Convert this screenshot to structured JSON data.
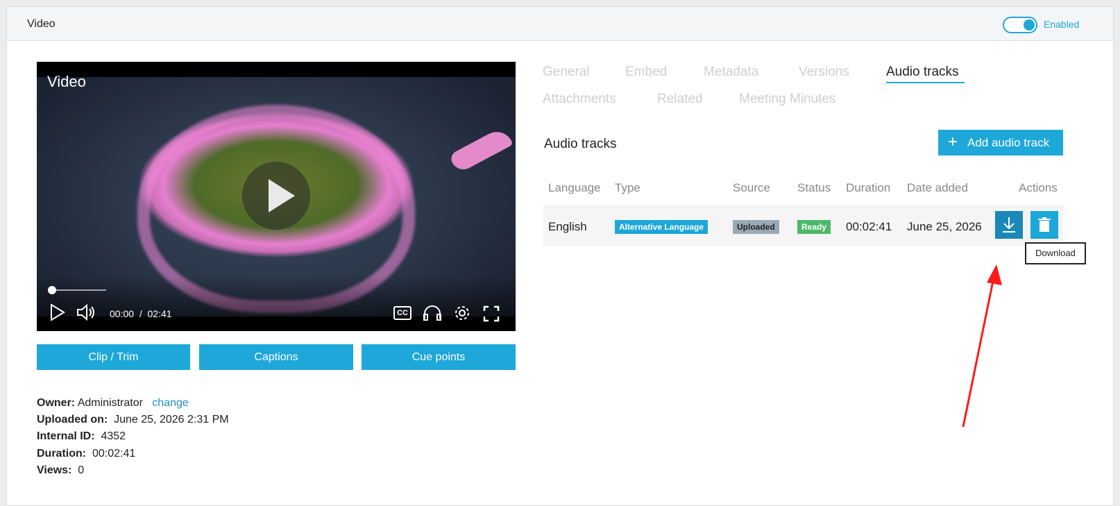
{
  "header": {
    "title": "Video",
    "toggle_label": "Enabled"
  },
  "player": {
    "title": "Video",
    "current_time": "00:00",
    "separator": "/",
    "total_time": "02:41",
    "cc_label": "CC",
    "progress_fraction": 0.03
  },
  "video_buttons": [
    {
      "label": "Clip / Trim"
    },
    {
      "label": "Captions"
    },
    {
      "label": "Cue points"
    }
  ],
  "info": {
    "owner_label": "Owner:",
    "owner_value": "Administrator",
    "owner_change": "change",
    "uploaded_label": "Uploaded on:",
    "uploaded_value": "June 25, 2026 2:31 PM",
    "id_label": "Internal ID:",
    "id_value": "4352",
    "duration_label": "Duration:",
    "duration_value": "00:02:41",
    "views_label": "Views:",
    "views_value": "0"
  },
  "tabs": [
    {
      "label": "General"
    },
    {
      "label": "Embed"
    },
    {
      "label": "Metadata"
    },
    {
      "label": "Versions"
    },
    {
      "label": "Audio tracks"
    },
    {
      "label": "Attachments"
    },
    {
      "label": "Related"
    },
    {
      "label": "Meeting Minutes"
    }
  ],
  "audio": {
    "section_title": "Audio tracks",
    "add_button": "Add audio track",
    "columns": [
      "Language",
      "Type",
      "Source",
      "Status",
      "Duration",
      "Date added",
      "Actions"
    ],
    "rows": [
      {
        "language": "English",
        "type": "Alternative Language",
        "source": "Uploaded",
        "status": "Ready",
        "duration": "00:02:41",
        "date": "June 25, 2026"
      }
    ],
    "tooltip": "Download"
  },
  "colors": {
    "accent": "#1ea7d9",
    "ready": "#4cb96a",
    "uploaded": "#9aa9b5",
    "annotation_arrow": "#ff1a1a"
  }
}
